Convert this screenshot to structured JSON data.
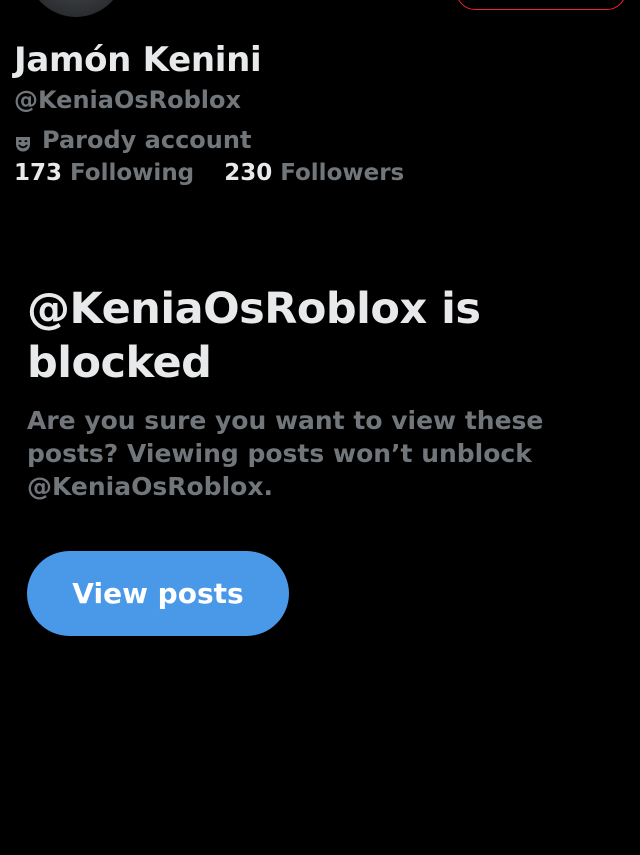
{
  "profile": {
    "display_name": "Jamón Kenini",
    "handle": "@KeniaOsRoblox",
    "parody_label": "Parody account",
    "parody_icon": "theater-mask-icon",
    "following_count": "173",
    "following_label": "Following",
    "followers_count": "230",
    "followers_label": "Followers"
  },
  "blocked": {
    "title": "@KeniaOsRoblox is blocked",
    "description": "Are you sure you want to view these posts? Viewing posts won’t unblock @KeniaOsRoblox.",
    "view_posts_label": "View posts"
  },
  "colors": {
    "background": "#000000",
    "primary_text": "#e7e9ea",
    "secondary_text": "#71767b",
    "button": "#4a99e9",
    "blocked_pill_border": "#f4212e"
  }
}
